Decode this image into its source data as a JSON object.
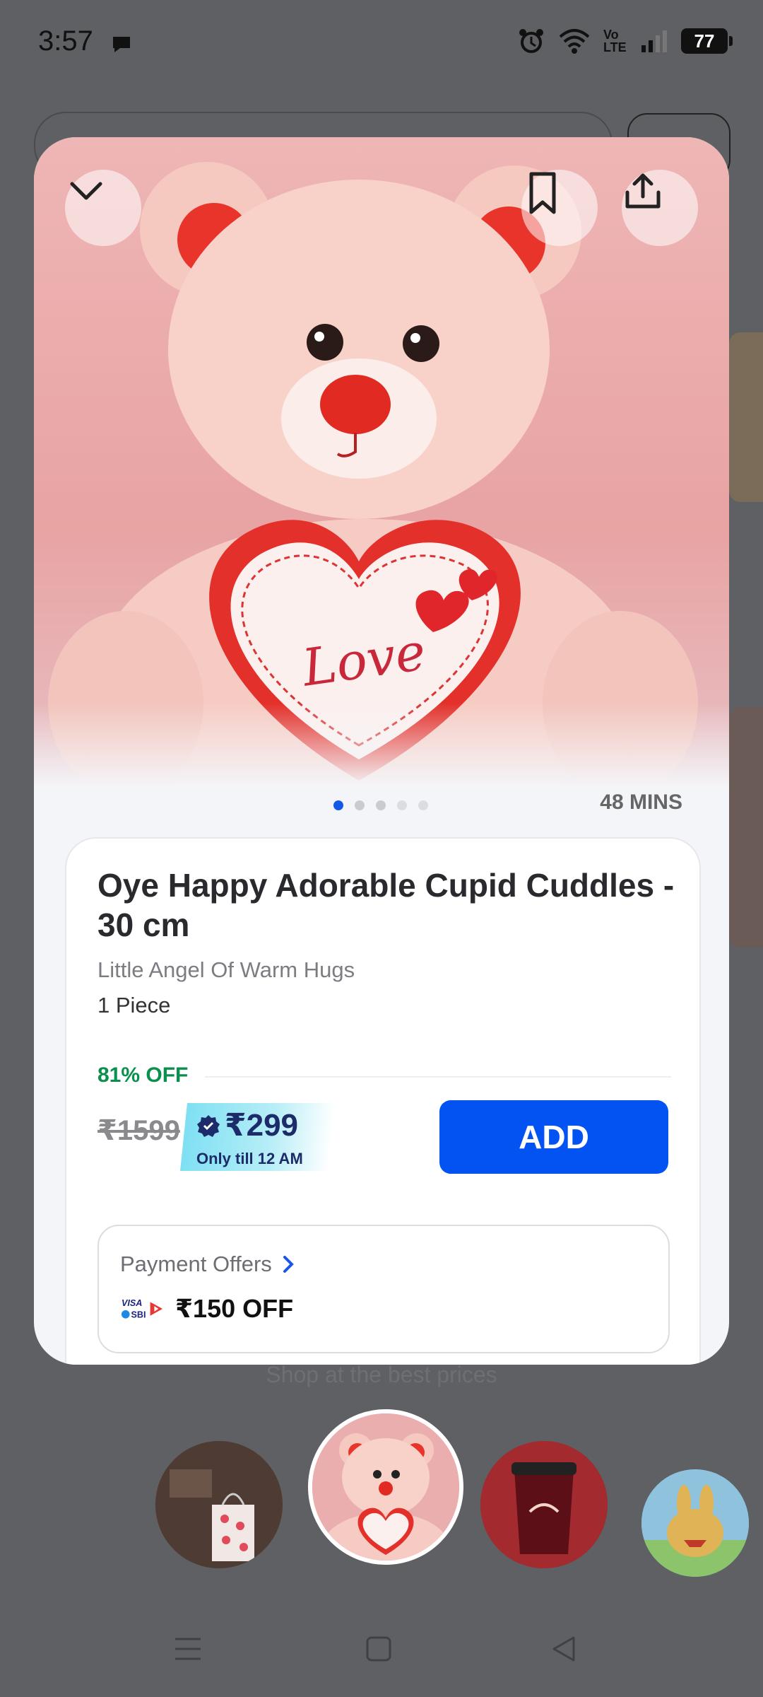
{
  "status_bar": {
    "time": "3:57",
    "battery": "77",
    "network": "Vo LTE"
  },
  "product": {
    "title": "Oye Happy Adorable Cupid Cuddles - 30 cm",
    "subtitle": "Little Angel Of Warm Hugs",
    "quantity": "1 Piece",
    "discount": "81% OFF",
    "mrp": "₹1599",
    "price": "₹299",
    "price_note": "Only till 12 AM",
    "add_label": "ADD",
    "delivery_time": "48 MINS",
    "image_pages": 5,
    "image_active_index": 0,
    "heart_text": "Love"
  },
  "payment_offers": {
    "title": "Payment Offers",
    "amount": "₹150 OFF",
    "bank": "VISA SBI"
  },
  "background": {
    "hint": "Shop at the best prices"
  },
  "colors": {
    "accent": "#0353f2",
    "discount": "#0a8f4d",
    "price": "#1c2c6b"
  },
  "icons": [
    "chevron-down-icon",
    "bookmark-icon",
    "share-icon",
    "chevron-right-icon",
    "menu-icon",
    "home-square-icon",
    "back-triangle-icon"
  ]
}
